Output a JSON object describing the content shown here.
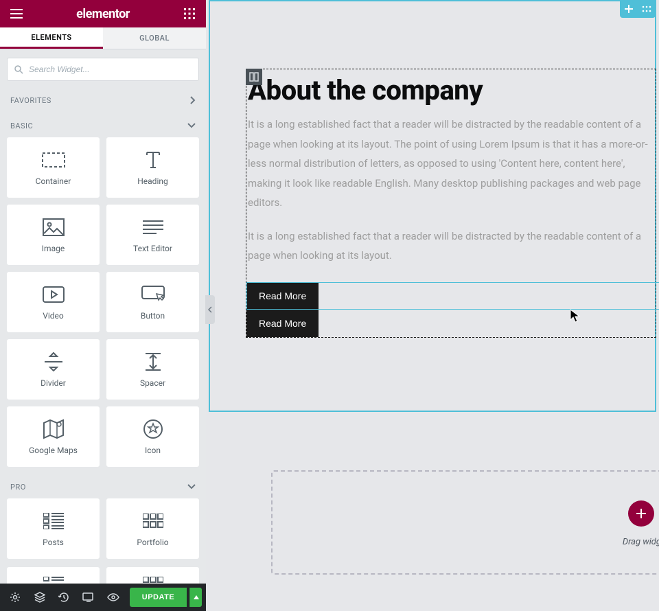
{
  "header": {
    "brand": "elementor"
  },
  "tabs": {
    "elements": "ELEMENTS",
    "global": "GLOBAL"
  },
  "search": {
    "placeholder": "Search Widget..."
  },
  "sections": {
    "favorites": "FAVORITES",
    "basic": "BASIC",
    "pro": "PRO"
  },
  "widgets_basic": [
    {
      "label": "Container",
      "icon": "container"
    },
    {
      "label": "Heading",
      "icon": "heading"
    },
    {
      "label": "Image",
      "icon": "image"
    },
    {
      "label": "Text Editor",
      "icon": "texteditor"
    },
    {
      "label": "Video",
      "icon": "video"
    },
    {
      "label": "Button",
      "icon": "button"
    },
    {
      "label": "Divider",
      "icon": "divider"
    },
    {
      "label": "Spacer",
      "icon": "spacer"
    },
    {
      "label": "Google Maps",
      "icon": "maps"
    },
    {
      "label": "Icon",
      "icon": "icon"
    }
  ],
  "widgets_pro": [
    {
      "label": "Posts",
      "icon": "posts"
    },
    {
      "label": "Portfolio",
      "icon": "portfolio"
    }
  ],
  "footer": {
    "update": "UPDATE"
  },
  "canvas": {
    "heading": "About the company",
    "para1": "It is a long established fact that a reader will be distracted by the readable content of a page when looking at its layout. The point of using Lorem Ipsum is that it has a more-or-less normal distribution of letters, as opposed to using 'Content here, content here', making it look like readable English. Many desktop publishing packages and web page editors.",
    "para2": "It is a long established fact that a reader will be distracted by the readable content of a page when looking at its layout.",
    "btn1": "Read More",
    "btn2": "Read More",
    "drop_hint": "Drag widg"
  }
}
